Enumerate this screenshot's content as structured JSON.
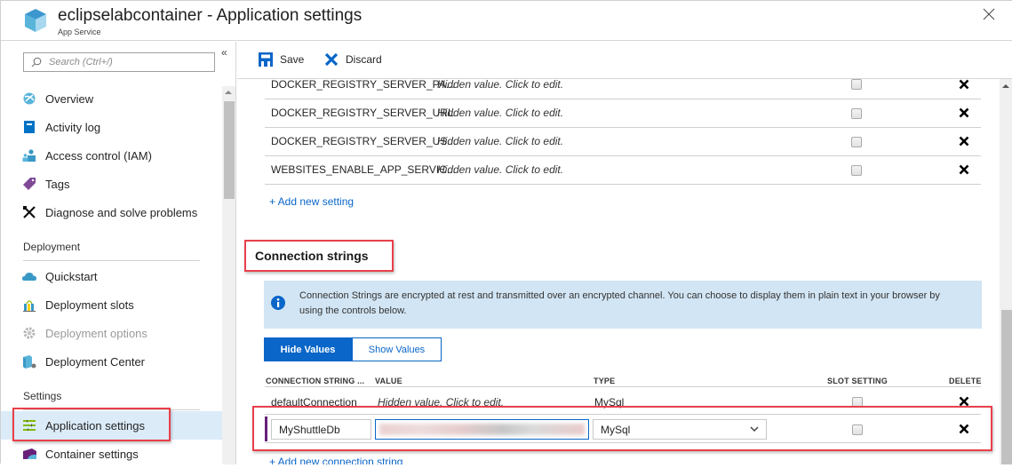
{
  "header": {
    "title": "eclipselabcontainer - Application settings",
    "subtitle": "App Service"
  },
  "sidebar": {
    "search_placeholder": "Search (Ctrl+/)",
    "collapse_glyph": "«",
    "items_top": [
      {
        "label": "Overview",
        "icon": "globe-icon"
      },
      {
        "label": "Activity log",
        "icon": "log-book-icon"
      },
      {
        "label": "Access control (IAM)",
        "icon": "people-icon"
      },
      {
        "label": "Tags",
        "icon": "tag-icon"
      },
      {
        "label": "Diagnose and solve problems",
        "icon": "wrench-icon"
      }
    ],
    "sections": [
      {
        "label": "Deployment",
        "items": [
          {
            "label": "Quickstart",
            "icon": "cloud-icon",
            "disabled": false
          },
          {
            "label": "Deployment slots",
            "icon": "slots-icon",
            "disabled": false
          },
          {
            "label": "Deployment options",
            "icon": "gear-icon",
            "disabled": true
          },
          {
            "label": "Deployment Center",
            "icon": "deployment-center-icon",
            "disabled": false
          }
        ]
      },
      {
        "label": "Settings",
        "items": [
          {
            "label": "Application settings",
            "icon": "settings-list-icon",
            "active": true
          },
          {
            "label": "Container settings",
            "icon": "container-icon"
          }
        ]
      }
    ]
  },
  "toolbar": {
    "save_label": "Save",
    "discard_label": "Discard"
  },
  "app_settings": {
    "rows": [
      {
        "name": "DOCKER_REGISTRY_SERVER_PA...",
        "value": "Hidden value. Click to edit.",
        "slot_setting": false
      },
      {
        "name": "DOCKER_REGISTRY_SERVER_URL",
        "value": "Hidden value. Click to edit.",
        "slot_setting": false
      },
      {
        "name": "DOCKER_REGISTRY_SERVER_US...",
        "value": "Hidden value. Click to edit.",
        "slot_setting": false
      },
      {
        "name": "WEBSITES_ENABLE_APP_SERVIC...",
        "value": "Hidden value. Click to edit.",
        "slot_setting": false
      }
    ],
    "add_label": "+ Add new setting"
  },
  "connection_strings": {
    "title": "Connection strings",
    "info": "Connection Strings are encrypted at rest and transmitted over an encrypted channel. You can choose to display them in plain text in your browser by using the controls below.",
    "toggle": {
      "hide": "Hide Values",
      "show": "Show Values",
      "selected": "hide"
    },
    "columns": {
      "name": "CONNECTION STRING ...",
      "value": "VALUE",
      "type": "TYPE",
      "slot": "SLOT SETTING",
      "delete": "DELETE"
    },
    "rows": [
      {
        "name": "defaultConnection",
        "value": "Hidden value. Click to edit.",
        "type": "MySql",
        "slot_setting": false
      }
    ],
    "edit_row": {
      "name": "MyShuttleDb",
      "value": "",
      "type": "MySql",
      "slot_setting": false
    },
    "add_label": "+ Add new connection string"
  },
  "colors": {
    "accent": "#0a66c8",
    "highlight": "#e8404a",
    "active_nav": "#dcebf8",
    "info_bg": "#d2e5f4"
  }
}
